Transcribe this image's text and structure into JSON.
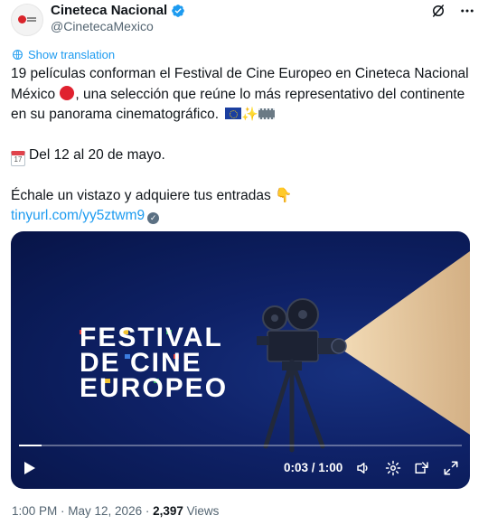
{
  "author": {
    "display_name": "Cineteca Nacional",
    "handle": "@CinetecaMexico"
  },
  "translate_label": "Show translation",
  "tweet": {
    "line1_before": "19 películas conforman el Festival de Cine Europeo en Cineteca Nacional México",
    "line1_after": ", una selección que reúne lo más representativo del continente en su panorama cinematográfico.",
    "calendar_day": "17",
    "dates": "Del 12 al 20 de mayo.",
    "cta": "Échale un vistazo y adquiere tus entradas",
    "link": "tinyurl.com/yy5ztwm9"
  },
  "media": {
    "title_lines": [
      "FESTIVAL",
      "DE CINE",
      "EUROPEO"
    ],
    "current_time": "0:03",
    "duration": "1:00",
    "time_display": "0:03 / 1:00",
    "progress_fraction": 0.05
  },
  "footer": {
    "time": "1:00 PM",
    "separator": " · ",
    "date": "May 12, 2026",
    "views_count": "2,397",
    "views_label": "Views"
  },
  "colors": {
    "accent": "#1d9bf0",
    "text": "#0f1419",
    "muted": "#536471",
    "media_bg": "#0f2268"
  }
}
